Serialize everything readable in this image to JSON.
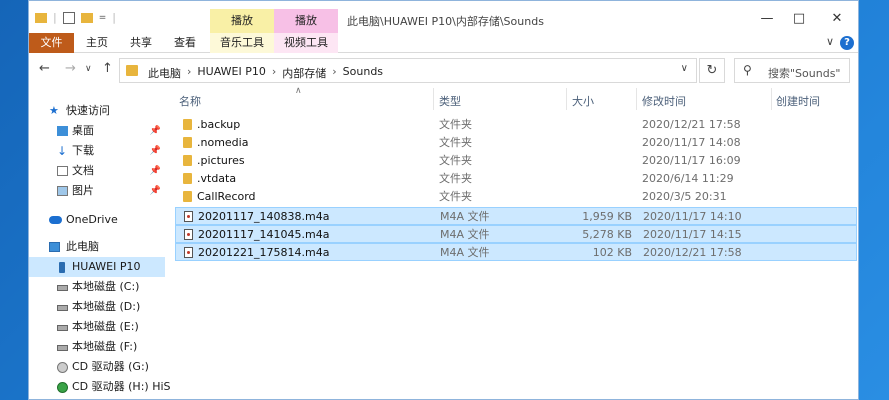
{
  "window": {
    "title": "此电脑\\HUAWEI P10\\内部存储\\Sounds",
    "context_tabs": [
      "播放",
      "播放"
    ]
  },
  "ribbon": {
    "tabs": [
      "文件",
      "主页",
      "共享",
      "查看",
      "音乐工具",
      "视频工具"
    ]
  },
  "address": {
    "crumbs": [
      "此电脑",
      "HUAWEI P10",
      "内部存储",
      "Sounds"
    ],
    "search_placeholder": "搜索\"Sounds\""
  },
  "nav": {
    "items": [
      {
        "label": "快速访问",
        "icon": "star-icon"
      },
      {
        "label": "桌面",
        "icon": "desktop-icon"
      },
      {
        "label": "下载",
        "icon": "download-icon"
      },
      {
        "label": "文档",
        "icon": "document-icon"
      },
      {
        "label": "图片",
        "icon": "picture-icon"
      },
      {
        "label": "OneDrive",
        "icon": "cloud-icon"
      },
      {
        "label": "此电脑",
        "icon": "computer-icon"
      },
      {
        "label": "HUAWEI P10",
        "icon": "phone-icon"
      },
      {
        "label": "本地磁盘 (C:)",
        "icon": "drive-icon"
      },
      {
        "label": "本地磁盘 (D:)",
        "icon": "drive-icon"
      },
      {
        "label": "本地磁盘 (E:)",
        "icon": "drive-icon"
      },
      {
        "label": "本地磁盘 (F:)",
        "icon": "drive-icon"
      },
      {
        "label": "CD 驱动器 (G:)",
        "icon": "cd-icon"
      },
      {
        "label": "CD 驱动器 (H:) HiS",
        "icon": "cd-icon"
      }
    ]
  },
  "columns": {
    "name": "名称",
    "type": "类型",
    "size": "大小",
    "modified": "修改时间",
    "created": "创建时间"
  },
  "files": [
    {
      "name": ".backup",
      "type": "文件夹",
      "size": "",
      "modified": "2020/12/21 17:58"
    },
    {
      "name": ".nomedia",
      "type": "文件夹",
      "size": "",
      "modified": "2020/11/17 14:08"
    },
    {
      "name": ".pictures",
      "type": "文件夹",
      "size": "",
      "modified": "2020/11/17 16:09"
    },
    {
      "name": ".vtdata",
      "type": "文件夹",
      "size": "",
      "modified": "2020/6/14 11:29"
    },
    {
      "name": "CallRecord",
      "type": "文件夹",
      "size": "",
      "modified": "2020/3/5 20:31"
    },
    {
      "name": "20201117_140838.m4a",
      "type": "M4A 文件",
      "size": "1,959 KB",
      "modified": "2020/11/17 14:10"
    },
    {
      "name": "20201117_141045.m4a",
      "type": "M4A 文件",
      "size": "5,278 KB",
      "modified": "2020/11/17 14:15"
    },
    {
      "name": "20201221_175814.m4a",
      "type": "M4A 文件",
      "size": "102 KB",
      "modified": "2020/12/21 17:58"
    }
  ]
}
